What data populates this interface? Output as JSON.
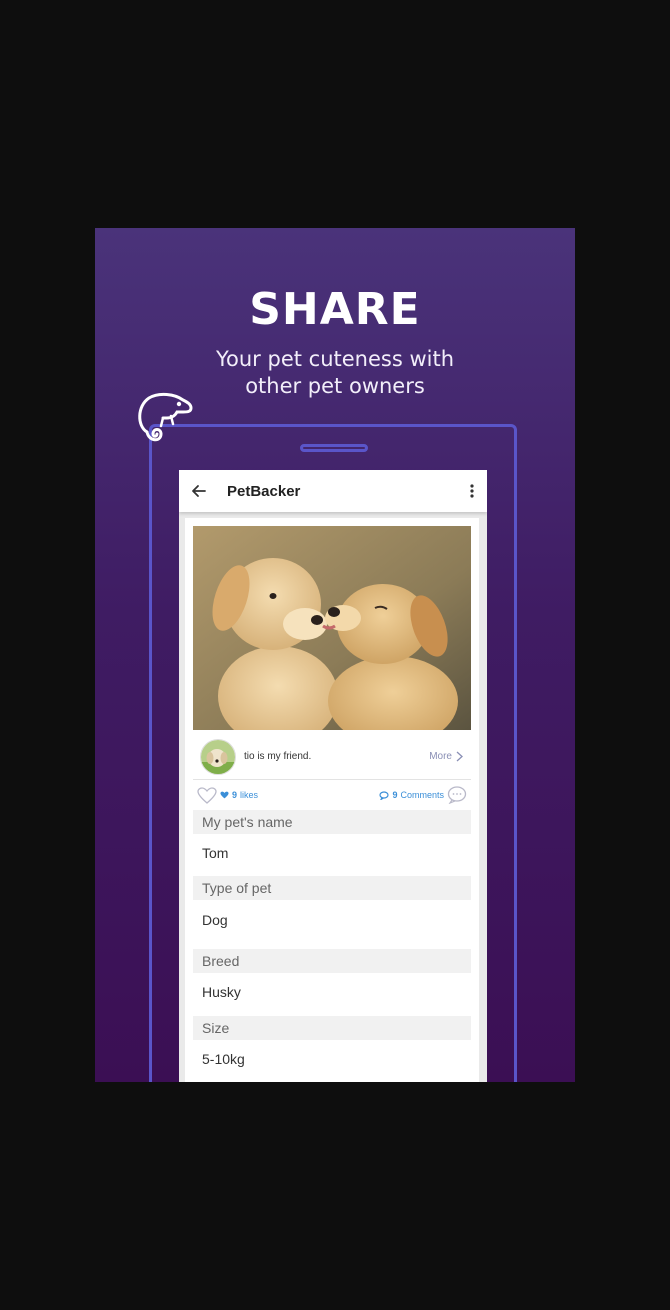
{
  "promo": {
    "headline": "SHARE",
    "subline_1": "Your pet cuteness with",
    "subline_2": "other pet owners",
    "background_top": "#4a337a",
    "background_bottom": "#3b0f54",
    "outline_color": "#5a55c9",
    "logo_icon": "chameleon-logo-icon"
  },
  "appbar": {
    "back_icon": "arrow-left-icon",
    "title": "PetBacker",
    "menu_icon": "more-vert-icon"
  },
  "post": {
    "photo": "two-puppies-photo",
    "caption": "tio is my friend.",
    "more_label": "More",
    "likes_count": "9",
    "likes_label": "likes",
    "comments_count": "9",
    "comments_label": "Comments",
    "accent_color": "#3b8fd8"
  },
  "details": [
    {
      "label": "My pet's name",
      "value": "Tom"
    },
    {
      "label": "Type of pet",
      "value": "Dog"
    },
    {
      "label": "Breed",
      "value": "Husky"
    },
    {
      "label": "Size",
      "value": "5-10kg"
    }
  ]
}
